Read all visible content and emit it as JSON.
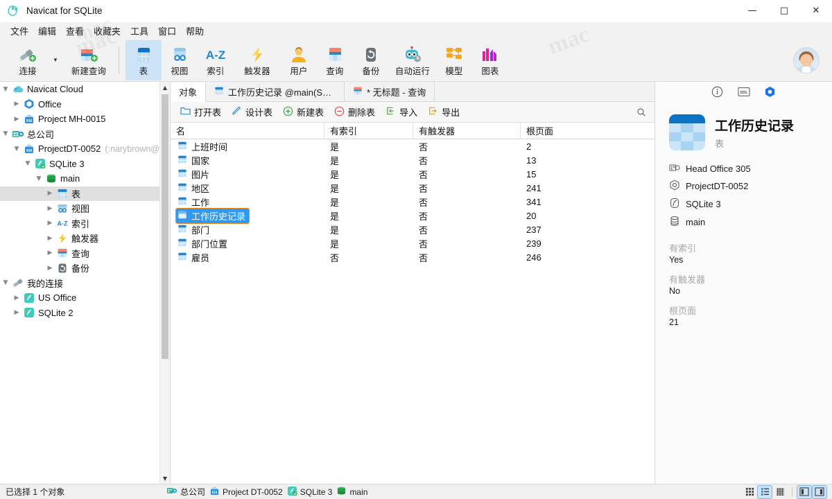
{
  "window": {
    "title": "Navicat for SQLite",
    "app_icon": "navicat-logo-icon",
    "minimize": "—",
    "maximize": "□",
    "close": "✕"
  },
  "menubar": {
    "items": [
      {
        "label": "文件"
      },
      {
        "label": "编辑"
      },
      {
        "label": "查看"
      },
      {
        "label": "收藏夹"
      },
      {
        "label": "工具"
      },
      {
        "label": "窗口"
      },
      {
        "label": "帮助"
      }
    ]
  },
  "toolbar": {
    "items": [
      {
        "label": "连接",
        "icon": "connection-icon",
        "active": false
      },
      {
        "label": "新建查询",
        "icon": "new-query-icon",
        "active": false
      },
      {
        "label": "表",
        "icon": "table-icon",
        "active": true
      },
      {
        "label": "视图",
        "icon": "view-icon",
        "active": false
      },
      {
        "label": "索引",
        "icon": "index-az-icon",
        "active": false
      },
      {
        "label": "触发器",
        "icon": "trigger-bolt-icon",
        "active": false
      },
      {
        "label": "用户",
        "icon": "user-icon",
        "active": false
      },
      {
        "label": "查询",
        "icon": "query-icon",
        "active": false
      },
      {
        "label": "备份",
        "icon": "backup-icon",
        "active": false
      },
      {
        "label": "自动运行",
        "icon": "automation-robot-icon",
        "active": false
      },
      {
        "label": "模型",
        "icon": "model-icon",
        "active": false
      },
      {
        "label": "图表",
        "icon": "chart-icon",
        "active": false
      }
    ],
    "avatar_name": "user-avatar"
  },
  "sidebar": {
    "nodes": [
      {
        "label": "Navicat Cloud",
        "indent": 0,
        "twisty": "down",
        "icon": "cloud-icon",
        "selected": false
      },
      {
        "label": "Office",
        "indent": 1,
        "twisty": "right",
        "icon": "project-office-icon",
        "selected": false
      },
      {
        "label": "Project MH-0015",
        "indent": 1,
        "twisty": "right",
        "icon": "project-icon",
        "selected": false
      },
      {
        "label": "总公司",
        "indent": 0,
        "twisty": "down",
        "icon": "head-office-icon",
        "selected": false
      },
      {
        "label": "ProjectDT-0052",
        "sub": "(:narybrown@",
        "indent": 1,
        "twisty": "down",
        "icon": "project-icon",
        "selected": false
      },
      {
        "label": "SQLite 3",
        "indent": 2,
        "twisty": "down",
        "icon": "sqlite-connected-icon",
        "selected": false
      },
      {
        "label": "main",
        "indent": 3,
        "twisty": "down",
        "icon": "database-icon",
        "selected": false
      },
      {
        "label": "表",
        "indent": 4,
        "twisty": "right",
        "icon": "table-icon",
        "selected": true
      },
      {
        "label": "视图",
        "indent": 4,
        "twisty": "right",
        "icon": "view-icon",
        "selected": false
      },
      {
        "label": "索引",
        "indent": 4,
        "twisty": "right",
        "icon": "index-az-icon",
        "selected": false
      },
      {
        "label": "触发器",
        "indent": 4,
        "twisty": "right",
        "icon": "trigger-bolt-icon",
        "selected": false
      },
      {
        "label": "查询",
        "indent": 4,
        "twisty": "right",
        "icon": "query-icon",
        "selected": false
      },
      {
        "label": "备份",
        "indent": 4,
        "twisty": "right",
        "icon": "backup-icon",
        "selected": false
      },
      {
        "label": "我的连接",
        "indent": 0,
        "twisty": "down",
        "icon": "connection-plug-icon",
        "selected": false
      },
      {
        "label": "US Office",
        "indent": 1,
        "twisty": "right",
        "icon": "sqlite-icon",
        "selected": false
      },
      {
        "label": "SQLite 2",
        "indent": 1,
        "twisty": "right",
        "icon": "sqlite-icon",
        "selected": false
      }
    ]
  },
  "tabs": [
    {
      "label": "对象",
      "icon": "",
      "active": true
    },
    {
      "label": "工作历史记录 @main(SQLi…",
      "icon": "table-icon",
      "active": false
    },
    {
      "label": "* 无标题 - 查询",
      "icon": "query-icon",
      "active": false
    }
  ],
  "actionbar": {
    "buttons": [
      {
        "label": "打开表",
        "icon": "open-table-icon"
      },
      {
        "label": "设计表",
        "icon": "design-table-icon"
      },
      {
        "label": "新建表",
        "icon": "new-table-icon"
      },
      {
        "label": "删除表",
        "icon": "delete-table-icon"
      },
      {
        "label": "导入",
        "icon": "import-icon"
      },
      {
        "label": "导出",
        "icon": "export-icon"
      }
    ],
    "search_icon": "search-icon"
  },
  "table_list": {
    "columns": [
      "名",
      "有索引",
      "有触发器",
      "根页面"
    ],
    "rows": [
      {
        "name": "上班时间",
        "indexed": "是",
        "trigger": "否",
        "rootpage": "2",
        "selected": false
      },
      {
        "name": "国家",
        "indexed": "是",
        "trigger": "否",
        "rootpage": "13",
        "selected": false
      },
      {
        "name": "图片",
        "indexed": "是",
        "trigger": "否",
        "rootpage": "15",
        "selected": false
      },
      {
        "name": "地区",
        "indexed": "是",
        "trigger": "否",
        "rootpage": "241",
        "selected": false
      },
      {
        "name": "工作",
        "indexed": "是",
        "trigger": "否",
        "rootpage": "341",
        "selected": false
      },
      {
        "name": "工作历史记录",
        "indexed": "是",
        "trigger": "否",
        "rootpage": "20",
        "selected": true
      },
      {
        "name": "部门",
        "indexed": "是",
        "trigger": "否",
        "rootpage": "237",
        "selected": false
      },
      {
        "name": "部门位置",
        "indexed": "是",
        "trigger": "否",
        "rootpage": "239",
        "selected": false
      },
      {
        "name": "雇员",
        "indexed": "否",
        "trigger": "否",
        "rootpage": "246",
        "selected": false
      }
    ]
  },
  "info_panel": {
    "tabs": [
      {
        "icon": "info-circle-icon",
        "active": true
      },
      {
        "icon": "ddl-icon",
        "active": false
      },
      {
        "icon": "hexagon-blue-icon",
        "active": false
      }
    ],
    "title": "工作历史记录",
    "subtitle": "表",
    "icon": "table-icon-large",
    "meta": [
      {
        "label": "Head Office 305",
        "icon": "head-office-icon"
      },
      {
        "label": "ProjectDT-0052",
        "icon": "project-outline-icon"
      },
      {
        "label": "SQLite 3",
        "icon": "sqlite-outline-icon"
      },
      {
        "label": "main",
        "icon": "database-outline-icon"
      }
    ],
    "properties": [
      {
        "key": "有索引",
        "value": "Yes"
      },
      {
        "key": "有触发器",
        "value": "No"
      },
      {
        "key": "根页面",
        "value": "21"
      }
    ]
  },
  "statusbar": {
    "text": "已选择 1 个对象",
    "breadcrumb": [
      {
        "label": "总公司",
        "icon": "head-office-icon"
      },
      {
        "label": "Project DT-0052",
        "icon": "project-icon"
      },
      {
        "label": "SQLite 3",
        "icon": "sqlite-connected-icon"
      },
      {
        "label": "main",
        "icon": "database-icon"
      }
    ],
    "view_modes": [
      {
        "icon": "grid-view-icon",
        "active": false
      },
      {
        "icon": "list-view-icon",
        "active": true
      },
      {
        "icon": "detail-view-icon",
        "active": false
      }
    ],
    "panel_toggles": [
      {
        "icon": "left-panel-toggle-icon",
        "active": true
      },
      {
        "icon": "right-panel-toggle-icon",
        "active": true
      }
    ]
  },
  "colors": {
    "accent": "#3399ee",
    "toolbar_active": "#cde3f7",
    "table_blue": "#0b72c4",
    "bg": "#f2f2f2"
  },
  "watermark": "mac"
}
